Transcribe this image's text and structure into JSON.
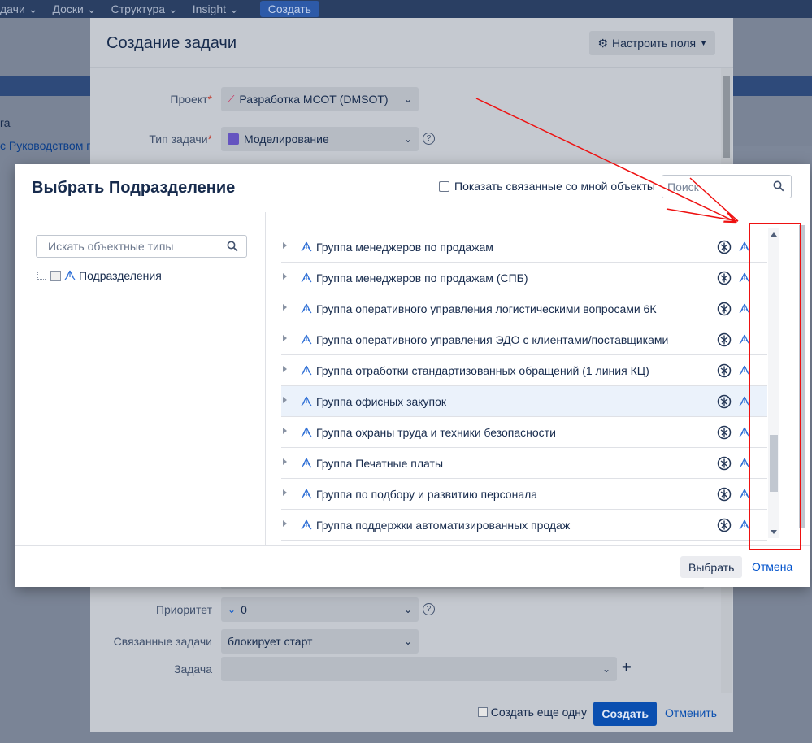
{
  "topnav": {
    "items": [
      "дачи",
      "Доски",
      "Структура",
      "Insight"
    ],
    "create_label": "Создать"
  },
  "background": {
    "text_fragment": "га",
    "link_fragment": "с Руководством г"
  },
  "create_dialog": {
    "title": "Создание задачи",
    "configure_fields_label": "Настроить поля",
    "project_label": "Проект",
    "project_value": "Разработка МСОТ (DMSOT)",
    "issue_type_label": "Тип задачи",
    "issue_type_value": "Моделирование",
    "priority_label": "Приоритет",
    "priority_value": "0",
    "linked_issues_label": "Связанные задачи",
    "linked_issues_value": "блокирует старт",
    "issue_label": "Задача",
    "create_another_label": "Создать еще одну",
    "create_button": "Создать",
    "cancel_button": "Отменить"
  },
  "modal": {
    "title": "Выбрать Подразделение",
    "show_related_label": "Показать связанные со мной объекты",
    "search_placeholder": "Поиск",
    "type_search_placeholder": "Искать объектные типы",
    "tree_root_label": "Подразделения",
    "items": [
      "Группа менеджеров по продажам",
      "Группа менеджеров по продажам (СПБ)",
      "Группа оперативного управления логистическими вопросами 6К",
      "Группа оперативного управления ЭДО с клиентами/поставщиками",
      "Группа отработки стандартизованных обращений (1 линия КЦ)",
      "Группа офисных закупок",
      "Группа охраны труда и техники безопасности",
      "Группа Печатные платы",
      "Группа по подбору и развитию персонала",
      "Группа поддержки автоматизированных продаж"
    ],
    "highlighted_index": 5,
    "select_button": "Выбрать",
    "cancel_button": "Отмена"
  },
  "colors": {
    "accent": "#0052cc",
    "annotation": "#ee1111",
    "highlight_row": "#ebf2fb"
  }
}
